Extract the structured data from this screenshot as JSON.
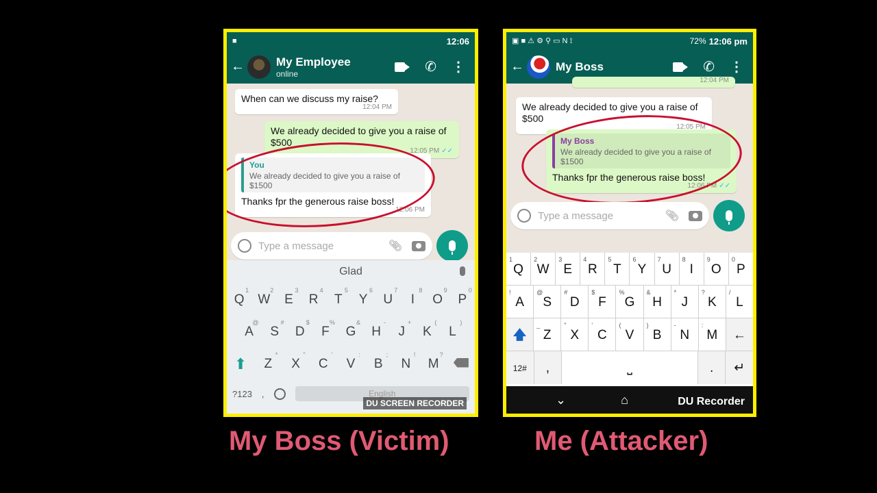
{
  "left": {
    "status_time": "12:06",
    "chat_title": "My Employee",
    "chat_subtitle": "online",
    "messages": [
      {
        "text": "When can we discuss my raise?",
        "time": "12:04 PM"
      },
      {
        "text": "We already decided to give you a raise of $500",
        "time": "12:05 PM"
      },
      {
        "quote_name": "You",
        "quote_text": "We already decided to give you a raise of $1500",
        "text": "Thanks fpr the generous raise boss!",
        "time": "12:06 PM"
      }
    ],
    "input_placeholder": "Type a message",
    "suggestion": "Glad",
    "keys_row1": [
      "Q",
      "W",
      "E",
      "R",
      "T",
      "Y",
      "U",
      "I",
      "O",
      "P"
    ],
    "keys_row1_sup": [
      "1",
      "2",
      "3",
      "4",
      "5",
      "6",
      "7",
      "8",
      "9",
      "0"
    ],
    "keys_row2": [
      "A",
      "S",
      "D",
      "F",
      "G",
      "H",
      "J",
      "K",
      "L"
    ],
    "keys_row2_sup": [
      "@",
      "#",
      "$",
      "%",
      "&",
      "-",
      "+",
      "(",
      ")"
    ],
    "keys_row3": [
      "Z",
      "X",
      "C",
      "V",
      "B",
      "N",
      "M"
    ],
    "keys_row3_sup": [
      "*",
      "\"",
      "'",
      ":",
      ";",
      "!",
      "?"
    ],
    "sym_key": "?123",
    "comma_key": ",",
    "space_label": "English",
    "watermark": "DU SCREEN RECORDER"
  },
  "right": {
    "status_battery": "72%",
    "status_time": "12:06 pm",
    "chat_title": "My Boss",
    "partial_time": "12:04 PM",
    "messages": [
      {
        "text": "We already decided to give you a raise of $500",
        "time": "12:05 PM"
      },
      {
        "quote_name": "My Boss",
        "quote_text": "We already decided to give you a raise of $1500",
        "text": "Thanks fpr the generous raise boss!",
        "time": "12:06 PM"
      }
    ],
    "input_placeholder": "Type a message",
    "keys_row1": [
      "Q",
      "W",
      "E",
      "R",
      "T",
      "Y",
      "U",
      "I",
      "O",
      "P"
    ],
    "keys_row1_sup": [
      "1",
      "2",
      "3",
      "4",
      "5",
      "6",
      "7",
      "8",
      "9",
      "0"
    ],
    "keys_row2": [
      "A",
      "S",
      "D",
      "F",
      "G",
      "H",
      "J",
      "K",
      "L"
    ],
    "keys_row2_sup": [
      "!",
      "@",
      "#",
      "$",
      "%",
      "&",
      "*",
      "?",
      "/"
    ],
    "keys_row3": [
      "Z",
      "X",
      "C",
      "V",
      "B",
      "N",
      "M"
    ],
    "keys_row3_sup": [
      "_",
      "\"",
      "'",
      "(",
      ")",
      "-",
      ":"
    ],
    "sym_key": "12#",
    "comma_key": ",",
    "period_key": ".",
    "du_label": "DU Recorder"
  },
  "captions": {
    "left": "My Boss (Victim)",
    "right": "Me (Attacker)"
  },
  "colors": {
    "frame": "#ffee00",
    "header": "#075e54",
    "outgoing": "#dcf8c6",
    "highlight": "#c8102e",
    "caption": "#e05a73"
  }
}
